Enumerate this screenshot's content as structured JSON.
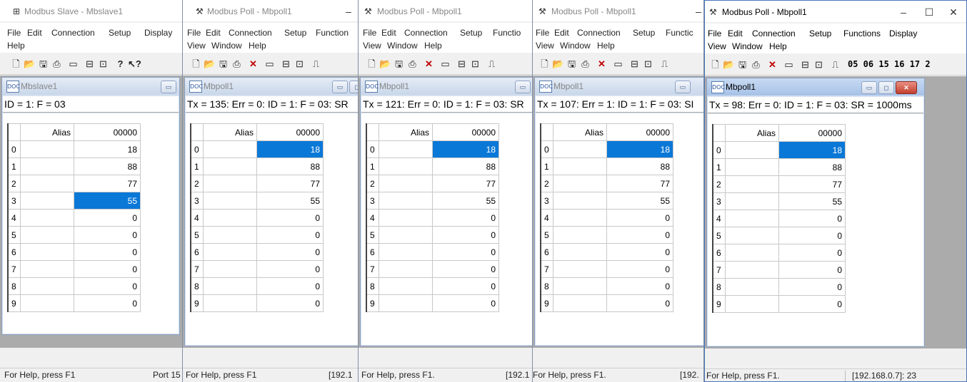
{
  "windows": [
    {
      "title": "Modbus Slave - Mbslave1",
      "menu": [
        "File",
        "Edit",
        "Connection",
        "Setup",
        "Display",
        "Help"
      ],
      "child_title": "Mbslave1",
      "status_line": "ID = 1: F = 03",
      "alias_header": "Alias",
      "col_header": "00000",
      "rows": [
        {
          "index": "0",
          "value": "18"
        },
        {
          "index": "1",
          "value": "88"
        },
        {
          "index": "2",
          "value": "77"
        },
        {
          "index": "3",
          "value": "55"
        },
        {
          "index": "4",
          "value": "0"
        },
        {
          "index": "5",
          "value": "0"
        },
        {
          "index": "6",
          "value": "0"
        },
        {
          "index": "7",
          "value": "0"
        },
        {
          "index": "8",
          "value": "0"
        },
        {
          "index": "9",
          "value": "0"
        }
      ],
      "selected_row": 3,
      "statusbar_help": "For Help, press F1",
      "statusbar_right": "Port 15"
    },
    {
      "title": "Modbus Poll - Mbpoll1",
      "menu": [
        "File",
        "Edit",
        "Connection",
        "Setup",
        "Function",
        "View",
        "Window",
        "Help"
      ],
      "child_title": "Mbpoll1",
      "status_line": "Tx = 135: Err = 0: ID = 1: F = 03: SR",
      "alias_header": "Alias",
      "col_header": "00000",
      "rows": [
        {
          "index": "0",
          "value": "18"
        },
        {
          "index": "1",
          "value": "88"
        },
        {
          "index": "2",
          "value": "77"
        },
        {
          "index": "3",
          "value": "55"
        },
        {
          "index": "4",
          "value": "0"
        },
        {
          "index": "5",
          "value": "0"
        },
        {
          "index": "6",
          "value": "0"
        },
        {
          "index": "7",
          "value": "0"
        },
        {
          "index": "8",
          "value": "0"
        },
        {
          "index": "9",
          "value": "0"
        }
      ],
      "selected_row": 0,
      "statusbar_help": "For Help, press F1",
      "statusbar_right": "[192.1"
    },
    {
      "title": "Modbus Poll - Mbpoll1",
      "menu": [
        "File",
        "Edit",
        "Connection",
        "Setup",
        "Functio",
        "View",
        "Window",
        "Help"
      ],
      "child_title": "Mbpoll1",
      "status_line": "Tx = 121: Err = 0: ID = 1: F = 03: SR",
      "alias_header": "Alias",
      "col_header": "00000",
      "rows": [
        {
          "index": "0",
          "value": "18"
        },
        {
          "index": "1",
          "value": "88"
        },
        {
          "index": "2",
          "value": "77"
        },
        {
          "index": "3",
          "value": "55"
        },
        {
          "index": "4",
          "value": "0"
        },
        {
          "index": "5",
          "value": "0"
        },
        {
          "index": "6",
          "value": "0"
        },
        {
          "index": "7",
          "value": "0"
        },
        {
          "index": "8",
          "value": "0"
        },
        {
          "index": "9",
          "value": "0"
        }
      ],
      "selected_row": 0,
      "statusbar_help": "For Help, press F1.",
      "statusbar_right": "[192.1"
    },
    {
      "title": "Modbus Poll - Mbpoll1",
      "menu": [
        "File",
        "Edit",
        "Connection",
        "Setup",
        "Functic",
        "View",
        "Window",
        "Help"
      ],
      "child_title": "Mbpoll1",
      "status_line": "Tx = 107: Err = 1: ID = 1: F = 03: SI",
      "alias_header": "Alias",
      "col_header": "00000",
      "rows": [
        {
          "index": "0",
          "value": "18"
        },
        {
          "index": "1",
          "value": "88"
        },
        {
          "index": "2",
          "value": "77"
        },
        {
          "index": "3",
          "value": "55"
        },
        {
          "index": "4",
          "value": "0"
        },
        {
          "index": "5",
          "value": "0"
        },
        {
          "index": "6",
          "value": "0"
        },
        {
          "index": "7",
          "value": "0"
        },
        {
          "index": "8",
          "value": "0"
        },
        {
          "index": "9",
          "value": "0"
        }
      ],
      "selected_row": 0,
      "statusbar_help": "For Help, press F1.",
      "statusbar_right": "[192."
    },
    {
      "title": "Modbus Poll - Mbpoll1",
      "menu": [
        "File",
        "Edit",
        "Connection",
        "Setup",
        "Functions",
        "Display",
        "View",
        "Window",
        "Help"
      ],
      "child_title": "Mbpoll1",
      "status_line": "Tx = 98: Err = 0: ID = 1: F = 03: SR = 1000ms",
      "alias_header": "Alias",
      "col_header": "00000",
      "rows": [
        {
          "index": "0",
          "value": "18"
        },
        {
          "index": "1",
          "value": "88"
        },
        {
          "index": "2",
          "value": "77"
        },
        {
          "index": "3",
          "value": "55"
        },
        {
          "index": "4",
          "value": "0"
        },
        {
          "index": "5",
          "value": "0"
        },
        {
          "index": "6",
          "value": "0"
        },
        {
          "index": "7",
          "value": "0"
        },
        {
          "index": "8",
          "value": "0"
        },
        {
          "index": "9",
          "value": "0"
        }
      ],
      "selected_row": 0,
      "statusbar_help": "For Help, press F1.",
      "statusbar_right": "[192.168.0.7]: 23",
      "function_codes": "05 06 15 16 17 2"
    }
  ],
  "icons": {
    "app_slave": "modbus-slave-icon",
    "app_poll": "modbus-poll-icon",
    "new": "new-file-icon",
    "open": "open-folder-icon",
    "save": "save-icon",
    "print": "print-icon",
    "delete": "delete-icon",
    "window": "window-icon",
    "connect": "connect-icon",
    "disconnect": "disconnect-icon",
    "pulse": "pulse-icon",
    "help": "help-icon",
    "context_help": "context-help-icon"
  },
  "colors": {
    "selection": "#0a78d7",
    "active_border": "#4a78b8"
  }
}
